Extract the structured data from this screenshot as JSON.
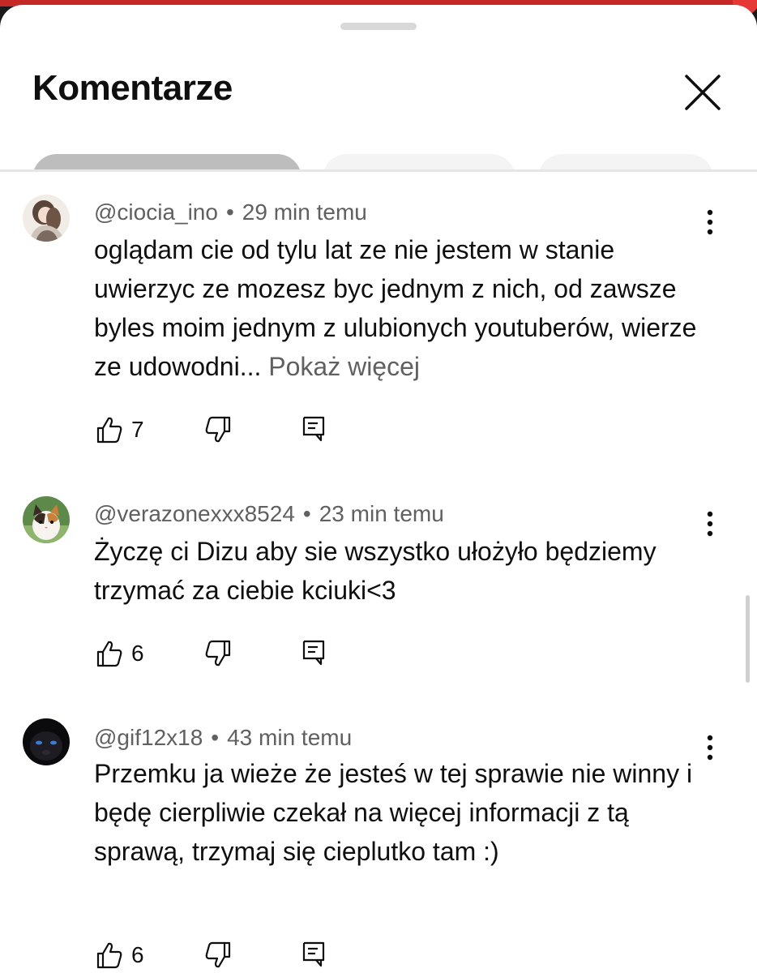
{
  "header": {
    "title": "Komentarze",
    "close_label": "close"
  },
  "filters": [
    {
      "label": "",
      "selected": true
    },
    {
      "label": "",
      "selected": false
    },
    {
      "label": "",
      "selected": false
    }
  ],
  "comments": [
    {
      "author": "@ciocia_ino",
      "separator": "•",
      "time": "29 min temu",
      "text": "oglądam cie od tylu lat ze nie jestem w stanie uwierzyc ze mozesz byc jednym z nich, od zawsze byles moim jednym z ulubionych youtuberów, wierze ze udowodni...",
      "more": "Pokaż więcej",
      "likes": "7",
      "avatar_icon": "anime-girl-avatar"
    },
    {
      "author": "@verazonexxx8524",
      "separator": "•",
      "time": "23 min temu",
      "text": "Życzę ci Dizu aby sie wszystko ułożyło będziemy trzymać za ciebie kciuki<3",
      "likes": "6",
      "avatar_icon": "cat-avatar"
    },
    {
      "author": "@gif12x18",
      "separator": "•",
      "time": "43 min temu",
      "text": "Przemku ja wieże że jesteś w tej sprawie nie winny i będę cierpliwie czekał na więcej informacji z tą sprawą, trzymaj się cieplutko tam :)",
      "likes": "6",
      "avatar_icon": "dark-animal-avatar"
    }
  ],
  "colors": {
    "accent": "#c62828",
    "text": "#0f0f0f",
    "secondary_text": "#606060",
    "chip_selected": "#bdbdbd",
    "chip": "#f4f4f4"
  }
}
